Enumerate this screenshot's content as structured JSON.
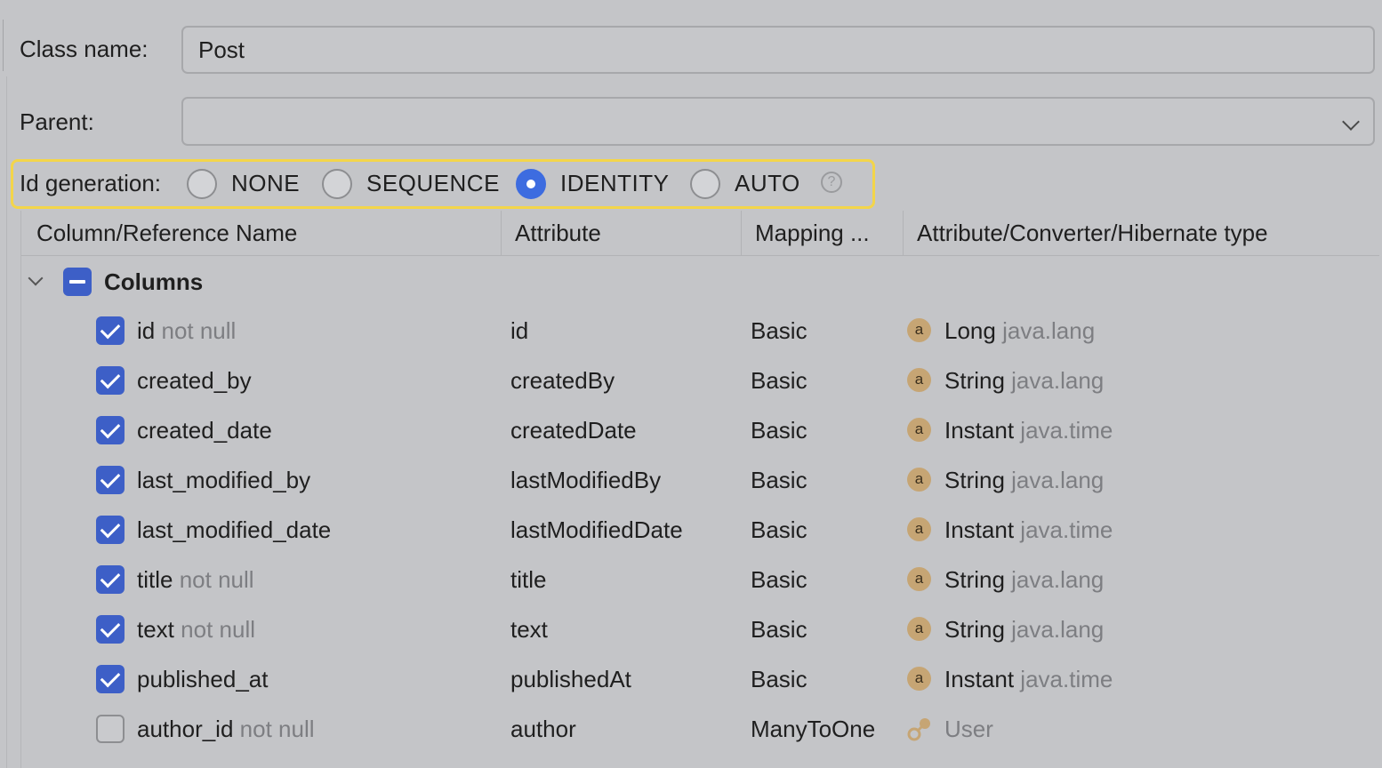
{
  "form": {
    "class_name_label": "Class name:",
    "class_name_value": "Post",
    "parent_label": "Parent:",
    "parent_value": ""
  },
  "id_generation": {
    "label": "Id generation:",
    "options": [
      "NONE",
      "SEQUENCE",
      "IDENTITY",
      "AUTO"
    ],
    "selected": "IDENTITY",
    "help_glyph": "?"
  },
  "table": {
    "headers": [
      "Column/Reference Name",
      "Attribute",
      "Mapping ...",
      "Attribute/Converter/Hibernate type"
    ],
    "group_label": "Columns",
    "rows": [
      {
        "name": "id",
        "constraint": "not null",
        "attribute": "id",
        "mapping": "Basic",
        "type": "Long",
        "package": "java.lang",
        "checked": true,
        "icon": "attribute-icon"
      },
      {
        "name": "created_by",
        "constraint": "",
        "attribute": "createdBy",
        "mapping": "Basic",
        "type": "String",
        "package": "java.lang",
        "checked": true,
        "icon": "attribute-icon"
      },
      {
        "name": "created_date",
        "constraint": "",
        "attribute": "createdDate",
        "mapping": "Basic",
        "type": "Instant",
        "package": "java.time",
        "checked": true,
        "icon": "attribute-icon"
      },
      {
        "name": "last_modified_by",
        "constraint": "",
        "attribute": "lastModifiedBy",
        "mapping": "Basic",
        "type": "String",
        "package": "java.lang",
        "checked": true,
        "icon": "attribute-icon"
      },
      {
        "name": "last_modified_date",
        "constraint": "",
        "attribute": "lastModifiedDate",
        "mapping": "Basic",
        "type": "Instant",
        "package": "java.time",
        "checked": true,
        "icon": "attribute-icon"
      },
      {
        "name": "title",
        "constraint": "not null",
        "attribute": "title",
        "mapping": "Basic",
        "type": "String",
        "package": "java.lang",
        "checked": true,
        "icon": "attribute-icon"
      },
      {
        "name": "text",
        "constraint": "not null",
        "attribute": "text",
        "mapping": "Basic",
        "type": "String",
        "package": "java.lang",
        "checked": true,
        "icon": "attribute-icon"
      },
      {
        "name": "published_at",
        "constraint": "",
        "attribute": "publishedAt",
        "mapping": "Basic",
        "type": "Instant",
        "package": "java.time",
        "checked": true,
        "icon": "attribute-icon"
      },
      {
        "name": "author_id",
        "constraint": "not null",
        "attribute": "author",
        "mapping": "ManyToOne",
        "type": "",
        "package": "User",
        "checked": false,
        "icon": "relation-icon"
      }
    ]
  },
  "colors": {
    "background": "#c4c5c8",
    "accent": "#3d5fc7",
    "highlight_border": "#f3d54a",
    "attribute_icon": "#c6a574"
  }
}
